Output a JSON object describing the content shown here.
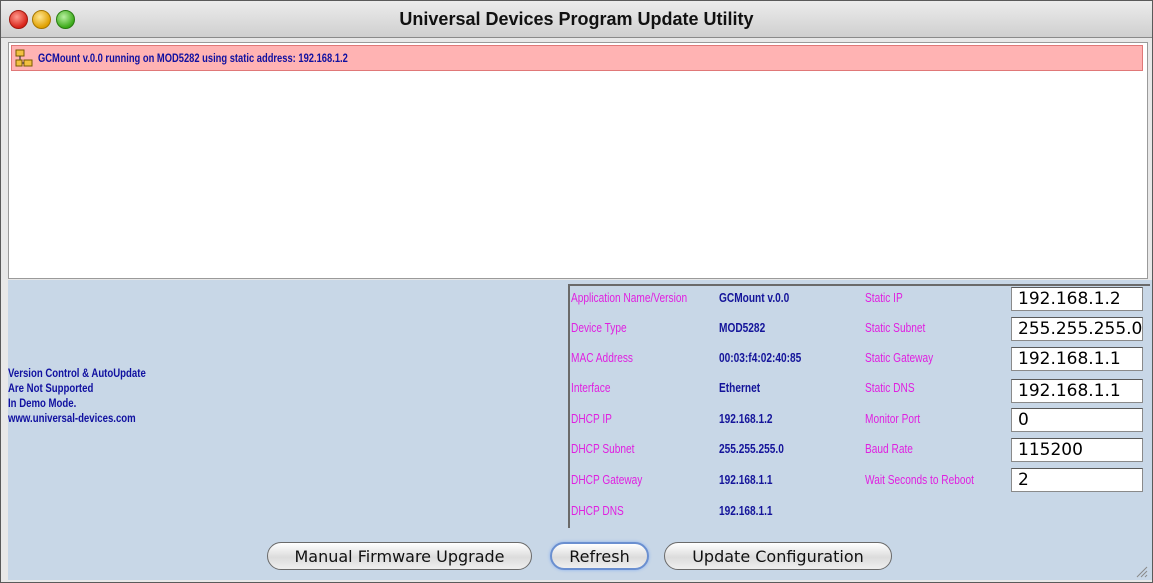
{
  "window": {
    "title": "Universal Devices Program Update Utility"
  },
  "device_list": {
    "rows": [
      {
        "icon": "network-icon",
        "text": "GCMount v.0.0 running on MOD5282  using static address: 192.168.1.2"
      }
    ],
    "row_bg": "#ffb3b3"
  },
  "notice": {
    "lines": [
      "Version Control & AutoUpdate",
      "Are Not Supported",
      "In Demo Mode.",
      "www.universal-devices.com"
    ]
  },
  "device_info": {
    "rows": [
      {
        "label": "Application Name/Version",
        "value": "GCMount v.0.0"
      },
      {
        "label": "Device Type",
        "value": "MOD5282"
      },
      {
        "label": "MAC Address",
        "value": "00:03:f4:02:40:85"
      },
      {
        "label": "Interface",
        "value": "Ethernet"
      },
      {
        "label": "DHCP IP",
        "value": "192.168.1.2"
      },
      {
        "label": "DHCP Subnet",
        "value": "255.255.255.0"
      },
      {
        "label": "DHCP Gateway",
        "value": "192.168.1.1"
      },
      {
        "label": "DHCP DNS",
        "value": "192.168.1.1"
      }
    ]
  },
  "config": {
    "rows": [
      {
        "label": "Static IP",
        "value": "192.168.1.2"
      },
      {
        "label": "Static Subnet",
        "value": "255.255.255.0"
      },
      {
        "label": "Static Gateway",
        "value": "192.168.1.1"
      },
      {
        "label": "Static DNS",
        "value": "192.168.1.1"
      },
      {
        "label": "Monitor Port",
        "value": "0"
      },
      {
        "label": "Baud Rate",
        "value": "115200"
      },
      {
        "label": "Wait Seconds to Reboot",
        "value": "2"
      }
    ]
  },
  "buttons": {
    "manual_firmware_upgrade": "Manual Firmware Upgrade",
    "refresh": "Refresh",
    "update_configuration": "Update Configuration"
  },
  "colors": {
    "label_magenta": "#e020e0",
    "value_navy": "#14149a",
    "panel_blue": "#c8d7e7",
    "highlight_row": "#ffb3b3"
  }
}
